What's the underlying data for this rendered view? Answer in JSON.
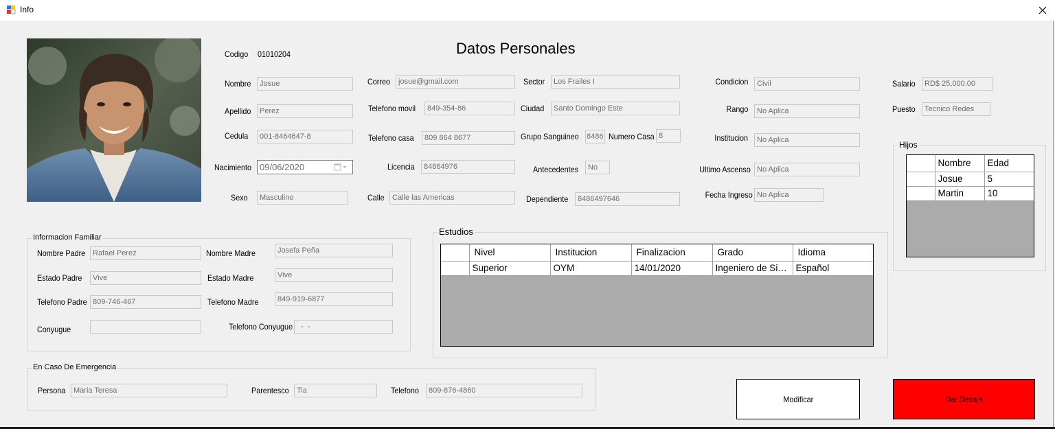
{
  "window": {
    "title": "Info"
  },
  "heading": "Datos Personales",
  "personal": {
    "codigo_label": "Codigo",
    "codigo_value": "01010204",
    "nombre_label": "Nombre",
    "nombre_value": "Josue",
    "apellido_label": "Apellido",
    "apellido_value": "Perez",
    "cedula_label": "Cedula",
    "cedula_value": "001-8464647-8",
    "nacimiento_label": "Nacimiento",
    "nacimiento_value": "09/06/2020",
    "sexo_label": "Sexo",
    "sexo_value": "Masculino",
    "correo_label": "Correo",
    "correo_value": "josue@gmail.com",
    "tel_movil_label": "Telefono movil",
    "tel_movil_value": "849-354-86",
    "tel_casa_label": "Telefono casa",
    "tel_casa_value": "809 864 8677",
    "licencia_label": "Licencia",
    "licencia_value": "84864976",
    "calle_label": "Calle",
    "calle_value": "Calle las Americas",
    "sector_label": "Sector",
    "sector_value": "Los Frailes I",
    "ciudad_label": "Ciudad",
    "ciudad_value": "Santo Domingo Este",
    "grupo_label": "Grupo Sanguineo",
    "grupo_value": "8486",
    "numero_casa_label": "Numero Casa",
    "numero_casa_value": "8",
    "antecedentes_label": "Antecedentes",
    "antecedentes_value": "No",
    "dependiente_label": "Dependiente",
    "dependiente_value": "8486497646",
    "condicion_label": "Condicion",
    "condicion_value": "Civil",
    "rango_label": "Rango",
    "rango_value": "No Aplica",
    "institucion_label": "Institucion",
    "institucion_value": "No Aplica",
    "ultimo_ascenso_label": "Ultimo Ascenso",
    "ultimo_ascenso_value": "No Aplica",
    "fecha_ingreso_label": "Fecha Ingreso",
    "fecha_ingreso_value": "No Aplica",
    "salario_label": "Salario",
    "salario_value": "RD$ 25,000.00",
    "puesto_label": "Puesto",
    "puesto_value": "Tecnico Redes"
  },
  "familiar": {
    "title": "Informacion Familiar",
    "padre_label": "Nombre Padre",
    "padre_value": "Rafael Perez",
    "madre_label": "Nombre Madre",
    "madre_value": "Josefa Peña",
    "estado_padre_label": "Estado Padre",
    "estado_padre_value": "Vive",
    "estado_madre_label": "Estado Madre",
    "estado_madre_value": "Vive",
    "tel_padre_label": "Telefono Padre",
    "tel_padre_value": "809-746-467",
    "tel_madre_label": "Telefono Madre",
    "tel_madre_value": "849-919-6877",
    "conyugue_label": "Conyugue",
    "conyugue_value": "",
    "tel_conyugue_label": "Telefono Conyugue",
    "tel_conyugue_value": "  -  -"
  },
  "emergencia": {
    "title": "En Caso De Emergencia",
    "persona_label": "Persona",
    "persona_value": "Maria Teresa",
    "parentesco_label": "Parentesco",
    "parentesco_value": "Tia",
    "telefono_label": "Telefono",
    "telefono_value": "809-876-4860"
  },
  "estudios": {
    "title": "Estudios",
    "columns": [
      "Nivel",
      "Institucion",
      "Finalizacion",
      "Grado",
      "Idioma"
    ],
    "rows": [
      [
        "Superior",
        "OYM",
        "14/01/2020",
        "Ingeniero de Sistemas",
        "Español"
      ]
    ]
  },
  "hijos": {
    "title": "Hijos",
    "columns": [
      "Nombre",
      "Edad"
    ],
    "rows": [
      [
        "Josue",
        "5"
      ],
      [
        "Martin",
        "10"
      ]
    ]
  },
  "buttons": {
    "modificar": "Modificar",
    "dar_debaja": "Dar Debaja"
  },
  "colors": {
    "danger": "#ff0000",
    "grid_bg": "#ababab"
  }
}
